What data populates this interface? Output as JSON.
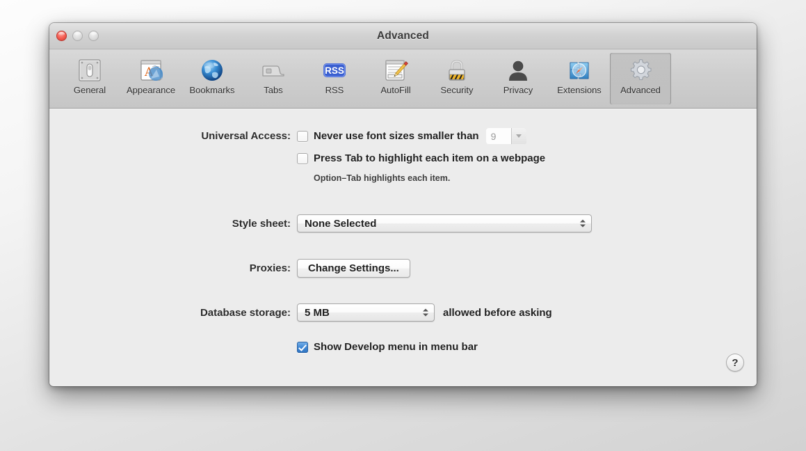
{
  "window": {
    "title": "Advanced",
    "traffic_lights": [
      {
        "name": "close",
        "color": "#f45b50"
      },
      {
        "name": "minimize",
        "color": "#dcdcdc"
      },
      {
        "name": "zoom",
        "color": "#dcdcdc"
      }
    ]
  },
  "toolbar": {
    "items": [
      {
        "label": "General",
        "icon": "general-icon",
        "selected": false
      },
      {
        "label": "Appearance",
        "icon": "appearance-icon",
        "selected": false
      },
      {
        "label": "Bookmarks",
        "icon": "bookmarks-icon",
        "selected": false
      },
      {
        "label": "Tabs",
        "icon": "tabs-icon",
        "selected": false
      },
      {
        "label": "RSS",
        "icon": "rss-icon",
        "selected": false
      },
      {
        "label": "AutoFill",
        "icon": "autofill-icon",
        "selected": false
      },
      {
        "label": "Security",
        "icon": "security-icon",
        "selected": false
      },
      {
        "label": "Privacy",
        "icon": "privacy-icon",
        "selected": false
      },
      {
        "label": "Extensions",
        "icon": "extensions-icon",
        "selected": false
      },
      {
        "label": "Advanced",
        "icon": "advanced-icon",
        "selected": true
      }
    ]
  },
  "main": {
    "universal_access": {
      "label": "Universal Access:",
      "font_size_checkbox": {
        "label": "Never use font sizes smaller than",
        "checked": false
      },
      "font_size_value": "9",
      "tab_highlight_checkbox": {
        "label": "Press Tab to highlight each item on a webpage",
        "checked": false
      },
      "tab_highlight_hint": "Option–Tab highlights each item."
    },
    "style_sheet": {
      "label": "Style sheet:",
      "value": "None Selected"
    },
    "proxies": {
      "label": "Proxies:",
      "button_label": "Change Settings..."
    },
    "database_storage": {
      "label": "Database storage:",
      "value": "5 MB",
      "suffix": "allowed before asking"
    },
    "develop_menu": {
      "label": "Show Develop menu in menu bar",
      "checked": true
    },
    "help_button_label": "?"
  }
}
